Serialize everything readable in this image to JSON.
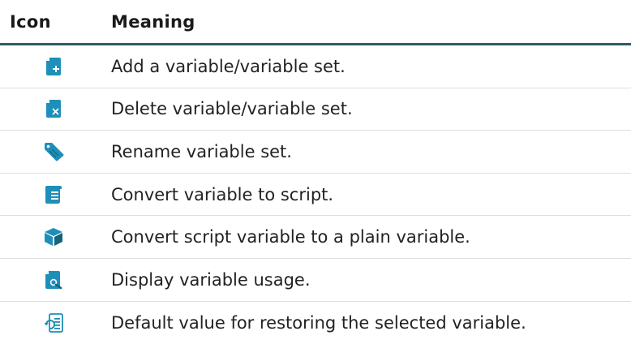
{
  "table": {
    "headers": {
      "icon": "Icon",
      "meaning": "Meaning"
    },
    "rows": [
      {
        "icon": "add-file-icon",
        "meaning": "Add a variable/variable set."
      },
      {
        "icon": "delete-file-icon",
        "meaning": "Delete variable/variable set."
      },
      {
        "icon": "tag-icon",
        "meaning": "Rename variable set."
      },
      {
        "icon": "script-icon",
        "meaning": "Convert variable to script."
      },
      {
        "icon": "cube-icon",
        "meaning": "Convert script variable to a plain variable."
      },
      {
        "icon": "search-file-icon",
        "meaning": "Display variable usage."
      },
      {
        "icon": "restore-default-icon",
        "meaning": "Default value for restoring the selected variable."
      }
    ]
  },
  "colors": {
    "icon_primary": "#1e8fb8",
    "icon_dark": "#17627d",
    "header_rule": "#2b5b6d"
  }
}
